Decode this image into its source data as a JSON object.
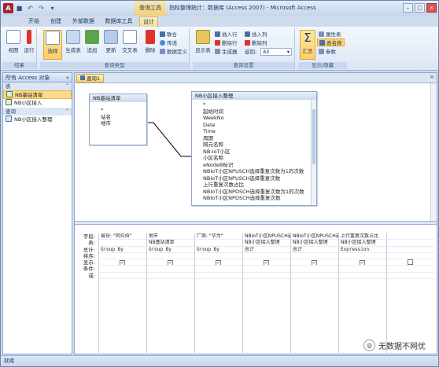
{
  "titlebar": {
    "context_tools": "查询工具",
    "title": "指标整理统计：数据库 (Access 2007) - Microsoft Access",
    "min": "–",
    "max": "□",
    "close": "×"
  },
  "qat": [
    "保存",
    "撤消",
    "重复",
    "自定义"
  ],
  "tabs": [
    "开始",
    "创建",
    "外部数据",
    "数据库工具",
    "设计"
  ],
  "ribbon": {
    "results": {
      "label": "结果",
      "view": "视图",
      "run": "运行"
    },
    "query_type": {
      "label": "查询类型",
      "select": "选择",
      "make_table": "生成表",
      "append": "追加",
      "update": "更新",
      "crosstab": "交叉表",
      "delete": "删除",
      "union": "联合",
      "pass_through": "传递",
      "data_definition": "数据定义"
    },
    "query_setup": {
      "label": "查询设置",
      "show_table": "显示表",
      "insert_rows": "插入行",
      "delete_rows": "删除行",
      "builder": "生成器",
      "insert_columns": "插入列",
      "delete_columns": "删除列",
      "return_label": "返回:",
      "return_value": "All"
    },
    "show_hide": {
      "label": "显示/隐藏",
      "totals": "汇总",
      "property_sheet": "属性表",
      "table_names": "表名称",
      "parameters": "参数"
    }
  },
  "nav": {
    "header": "所有 Access 对象",
    "sections": [
      {
        "name": "表",
        "items": [
          "NB基站清单",
          "NB小区接入"
        ]
      },
      {
        "name": "查询",
        "items": [
          "NB小区接入整理"
        ]
      }
    ]
  },
  "document": {
    "tab": "查询1",
    "close": "×"
  },
  "tables": [
    {
      "title": "NB基站清单",
      "fields": [
        "*",
        "站名",
        "地市"
      ]
    },
    {
      "title": "NB小区接入整理",
      "fields": [
        "*",
        "起始时间",
        "WeekNo",
        "Date",
        "Time",
        "周期",
        "网元名称",
        "NB-IoT小区",
        "小区名称",
        "eNodeB标识",
        "NBIoT小区NPUSCH选择重复次数为1的次数",
        "NBIoT小区NPUSCH选择重复次数",
        "上行重复次数占比",
        "NBIoT小区NPDSCH选择重复次数为1的次数",
        "NBIoT小区NPDSCH选择重复次数"
      ]
    }
  ],
  "grid": {
    "row_labels": [
      "字段:",
      "表:",
      "总计:",
      "排序:",
      "显示:",
      "条件:",
      "或:"
    ],
    "columns": [
      {
        "field": "省份: \"阿拉伯\"",
        "table": "",
        "total": "Group By",
        "show": true
      },
      {
        "field": "地市",
        "table": "NB基站清单",
        "total": "Group By",
        "show": true
      },
      {
        "field": "厂商: \"华为\"",
        "table": "",
        "total": "Group By",
        "show": true
      },
      {
        "field": "NBIoT小区NPUSCH选择",
        "table": "NB小区接入整理",
        "total": "总计",
        "show": true
      },
      {
        "field": "NBIoT小区NPUSCH选择",
        "table": "NB小区接入整理",
        "total": "总计",
        "show": true
      },
      {
        "field": "上行重复次数占比",
        "table": "NB小区接入整理",
        "total": "Expression",
        "show": true
      },
      {
        "field": "",
        "table": "",
        "total": "",
        "show": false
      }
    ]
  },
  "status": "就绪",
  "watermark": "无数据不网优"
}
